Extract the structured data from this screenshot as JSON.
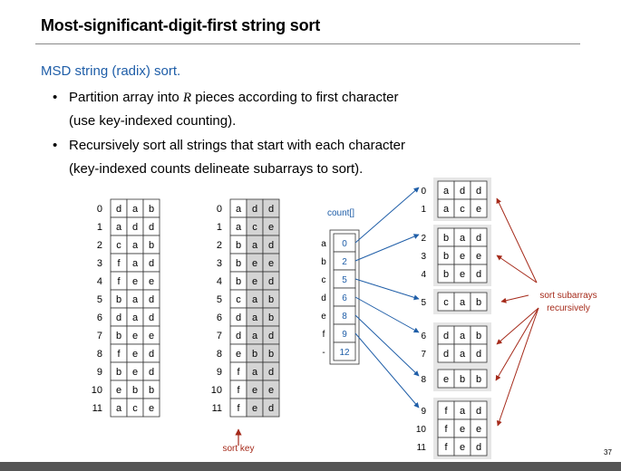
{
  "title": "Most-significant-digit-first string sort",
  "subhead": "MSD string (radix) sort.",
  "bullets": [
    {
      "line1": "Partition array into ",
      "var": "R",
      "line1b": " pieces according to first character",
      "line2": "(use key-indexed counting)."
    },
    {
      "line1": "Recursively sort all strings that start with each character",
      "var": "",
      "line1b": "",
      "line2": "(key-indexed counts delineate subarrays to sort)."
    }
  ],
  "page_number": "37",
  "diagram": {
    "indices": [
      "0",
      "1",
      "2",
      "3",
      "4",
      "5",
      "6",
      "7",
      "8",
      "9",
      "10",
      "11"
    ],
    "original": [
      "dab",
      "add",
      "cab",
      "fad",
      "fee",
      "bad",
      "dad",
      "bee",
      "fed",
      "bed",
      "ebb",
      "ace"
    ],
    "sorted": [
      "add",
      "ace",
      "bad",
      "bee",
      "bed",
      "cab",
      "dab",
      "dad",
      "ebb",
      "fad",
      "fee",
      "fed"
    ],
    "sort_key_label": "sort key",
    "count_label": "count[]",
    "count_chars": [
      "a",
      "b",
      "c",
      "d",
      "e",
      "f",
      "-"
    ],
    "count_values": [
      "0",
      "2",
      "5",
      "6",
      "8",
      "9",
      "12"
    ],
    "subarrays": [
      {
        "indices": [
          "0",
          "1"
        ],
        "rows": [
          "add",
          "ace"
        ]
      },
      {
        "indices": [
          "2",
          "3",
          "4"
        ],
        "rows": [
          "bad",
          "bee",
          "bed"
        ]
      },
      {
        "indices": [
          "5"
        ],
        "rows": [
          "cab"
        ]
      },
      {
        "indices": [
          "6",
          "7"
        ],
        "rows": [
          "dab",
          "dad"
        ]
      },
      {
        "indices": [
          "8"
        ],
        "rows": [
          "ebb"
        ]
      },
      {
        "indices": [
          "9",
          "10",
          "11"
        ],
        "rows": [
          "fad",
          "fee",
          "fed"
        ]
      }
    ],
    "recurse_label_line1": "sort subarrays",
    "recurse_label_line2": "recursively",
    "colors": {
      "cell_border": "#333333",
      "shade": "#d4d4d4",
      "blue": "#1f5ea8",
      "red": "#a52a1a",
      "white_cell": "#ffffff"
    }
  }
}
